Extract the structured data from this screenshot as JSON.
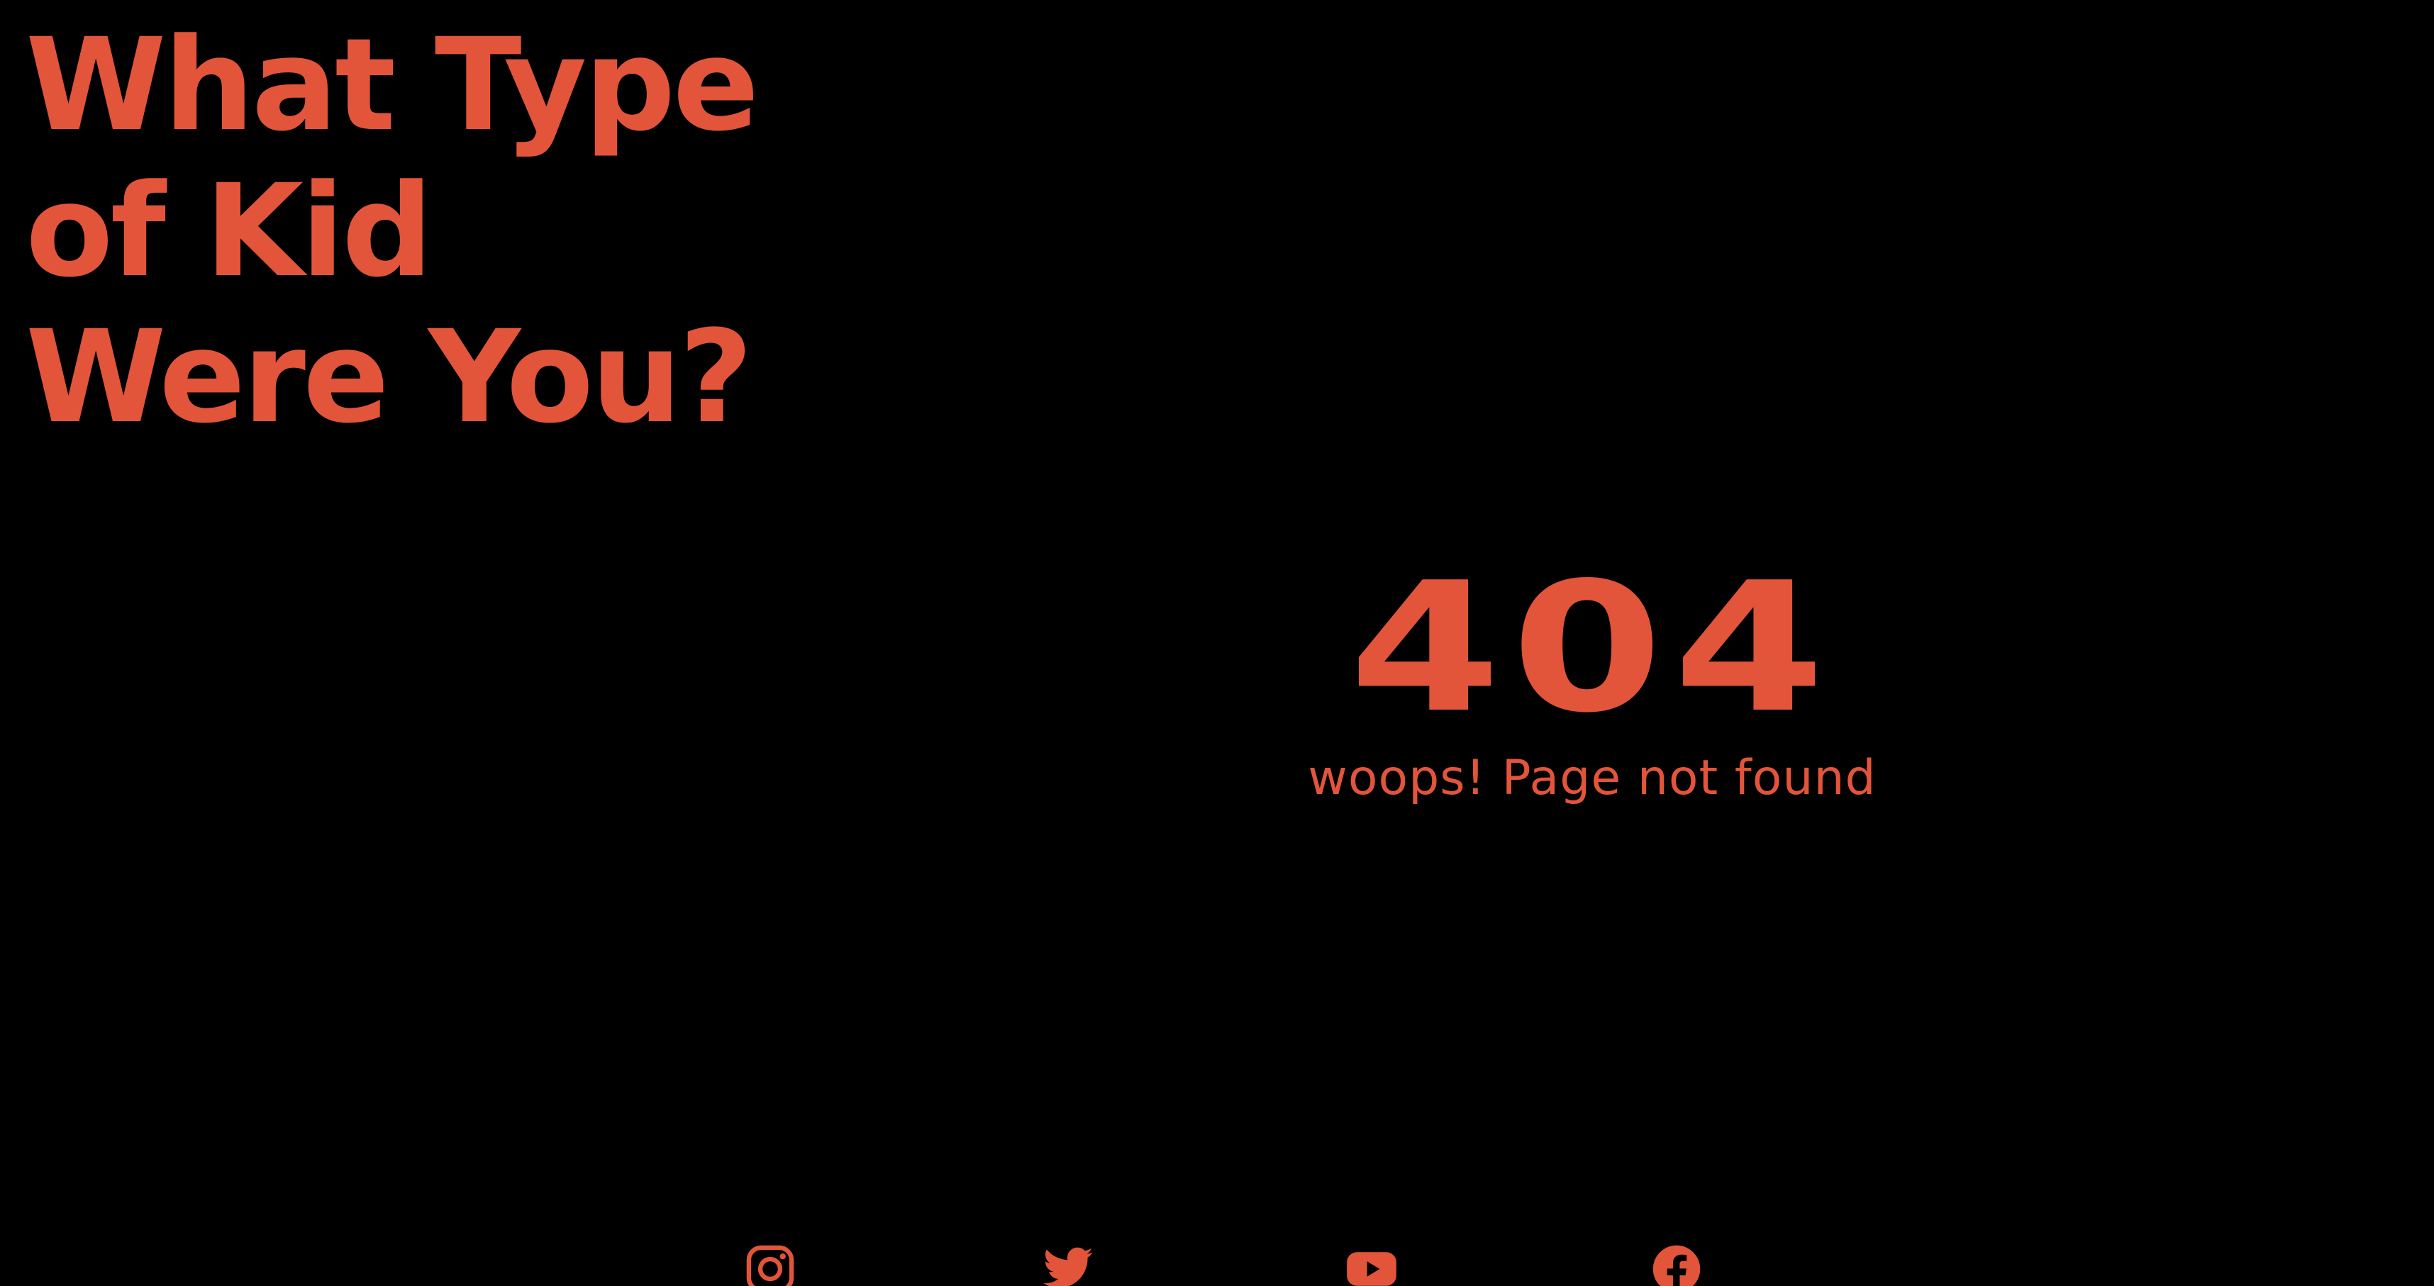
{
  "header": {
    "title_lines": [
      "What Type",
      "of Kid",
      "Were You?"
    ]
  },
  "error": {
    "code": "404",
    "message": "woops! Page not found"
  },
  "social_links": [
    {
      "icon": "instagram-icon"
    },
    {
      "icon": "twitter-icon"
    },
    {
      "icon": "youtube-icon"
    },
    {
      "icon": "facebook-icon"
    }
  ],
  "colors": {
    "background": "#000000",
    "accent": "#E2553A"
  }
}
